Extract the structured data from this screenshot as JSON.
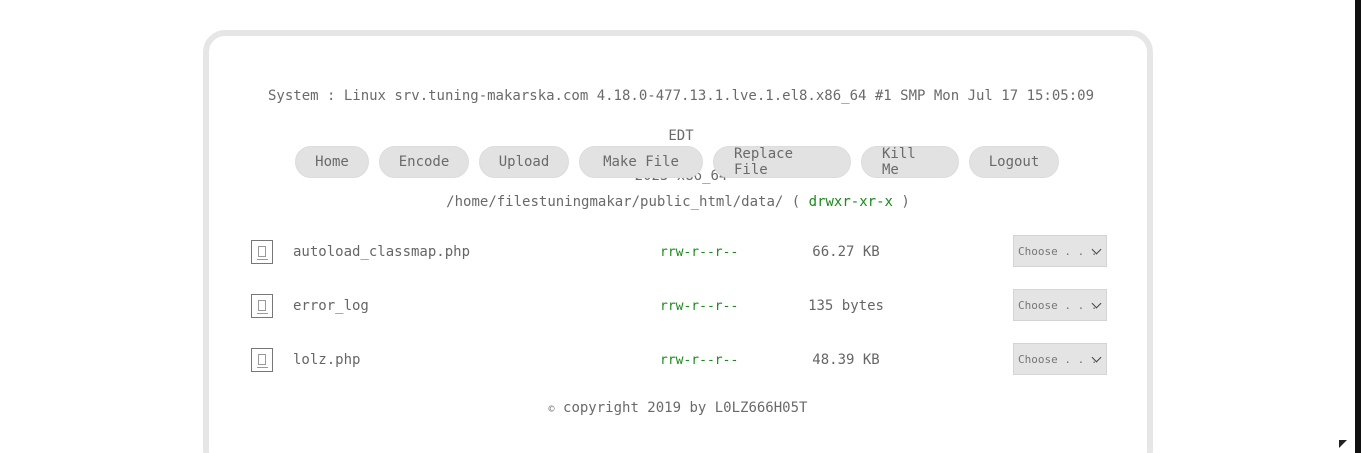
{
  "system_info": {
    "line1": "System : Linux srv.tuning-makarska.com 4.18.0-477.13.1.lve.1.el8.x86_64 #1 SMP Mon Jul 17 15:05:09 EDT",
    "line2": "2023 x86_64"
  },
  "nav": {
    "home": "Home",
    "encode": "Encode",
    "upload": "Upload",
    "make_file": "Make File",
    "replace_file": "Replace File",
    "kill_me": "Kill Me",
    "logout": "Logout"
  },
  "path": {
    "dir": "/home/filestuningmakar/public_html/data/",
    "open": "(",
    "perm": "drwxr-xr-x",
    "close": ")"
  },
  "files": [
    {
      "name": "autoload_classmap.php",
      "perm": "rrw-r--r--",
      "size": "66.27 KB",
      "action": "Choose . . ."
    },
    {
      "name": "error_log",
      "perm": "rrw-r--r--",
      "size": "135 bytes",
      "action": "Choose . . ."
    },
    {
      "name": "lolz.php",
      "perm": "rrw-r--r--",
      "size": "48.39 KB",
      "action": "Choose . . ."
    }
  ],
  "footer": {
    "symbol": "©",
    "text": "copyright 2019 by L0LZ666H05T"
  },
  "colors": {
    "accent_green": "#1a8a1a",
    "text_gray": "#666666",
    "button_bg": "#e2e2e2",
    "panel_border": "#e6e6e6"
  },
  "icons": {
    "file": "file-icon",
    "dropdown": "chevron-down-icon",
    "cursor": "mouse-cursor-icon"
  }
}
